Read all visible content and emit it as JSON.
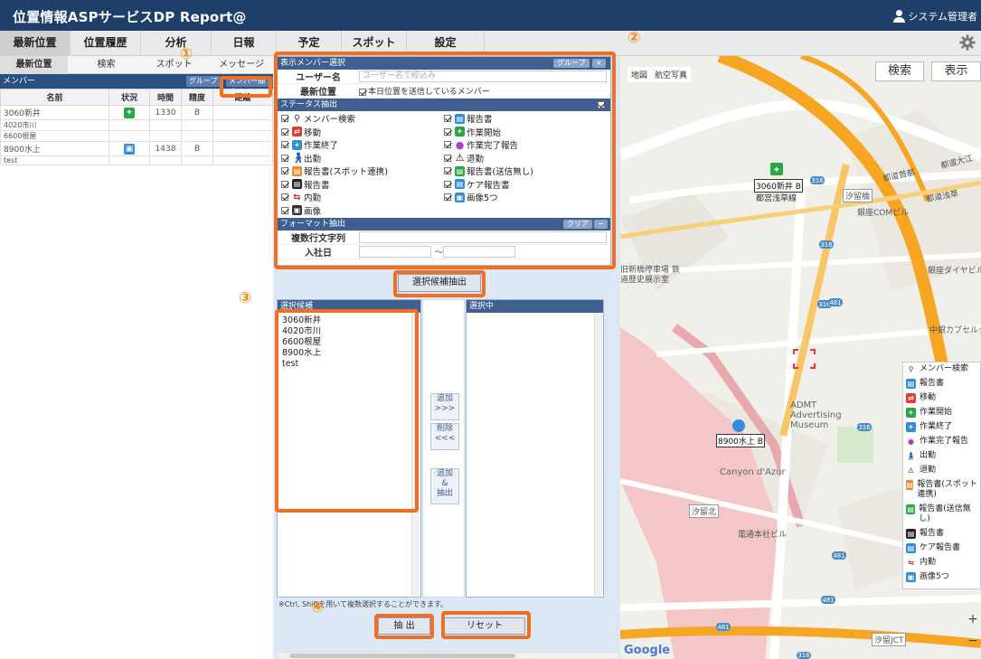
{
  "app": {
    "title": "位置情報ASPサービスDP Report@",
    "user": "システム管理者"
  },
  "nav": [
    "最新位置",
    "位置履歴",
    "分析",
    "日報",
    "予定",
    "スポット",
    "設定"
  ],
  "subtabs": [
    "最新位置",
    "検索",
    "スポット",
    "メッセージ"
  ],
  "member_bar": {
    "label": "メンバー",
    "group_btn": "グループ",
    "member_btn": "メンバー抽出"
  },
  "member_table": {
    "headers": [
      "名前",
      "状況",
      "時間",
      "精度",
      "距離"
    ],
    "rows": [
      {
        "name": "3060新井",
        "time": "1330",
        "acc": "B"
      },
      {
        "name": "4020市川",
        "time": "",
        "acc": ""
      },
      {
        "name": "6600根屋",
        "time": "",
        "acc": ""
      },
      {
        "name": "8900水上",
        "time": "1438",
        "acc": "B"
      },
      {
        "name": "test",
        "time": "",
        "acc": ""
      }
    ]
  },
  "dialog": {
    "header": "表示メンバー選択",
    "group_btn": "グループ",
    "close_btn": "×",
    "user_label": "ユーザー名",
    "user_placeholder": "ユーザー名で絞込み",
    "latest_label": "最新位置",
    "latest_check": "本日位置を送信しているメンバー",
    "status_header": "ステータス抽出",
    "statuses": [
      "メンバー検索",
      "報告書",
      "移動",
      "作業開始",
      "作業終了",
      "作業完了報告",
      "出勤",
      "退勤",
      "報告書(スポット連携)",
      "報告書(送信無し)",
      "報告書",
      "ケア報告書",
      "内勤",
      "画像5つ",
      "画像"
    ],
    "format_header": "フォーマット抽出",
    "clear_btn": "クリア",
    "minus_btn": "−",
    "multi_label": "複数行文字列",
    "join_label": "入社日",
    "tilde": "〜"
  },
  "extract_candidates_btn": "選択候補抽出",
  "candidates": {
    "header": "選択候補",
    "items": [
      "3060新井",
      "4020市川",
      "6600根屋",
      "8900水上",
      "test"
    ]
  },
  "selected": {
    "header": "選択中"
  },
  "move": {
    "add": "追加\n>>>",
    "remove": "削除\n<<<",
    "add_extract": "追加\n&\n抽出"
  },
  "note": "※Ctrl, Shiftを用いて複数選択することができます。",
  "actions": {
    "extract": "抽 出",
    "reset": "リセット"
  },
  "callouts": [
    "①",
    "②",
    "③",
    "④"
  ],
  "map": {
    "type_map": "地図",
    "type_photo": "航空写真",
    "search_btn": "検索",
    "display_btn": "表示",
    "pin1": "3060新井 B",
    "pin2": "8900水上 B",
    "station1": "都営浅草線",
    "poi1": "ADMT Advertising Museum",
    "poi2": "Canyon d'Azur",
    "poi3": "電通本社ビル",
    "poi4": "旧新橋停車場 鉄道歴史展示室",
    "poi5": "中銀カプセルタワー",
    "poi6": "銀座COMビル",
    "poi7": "銀座ダイヤビル",
    "road1": "都道首都",
    "road2": "都道浅草",
    "road3": "都道大江",
    "pill1": "汐留橋",
    "pill2": "汐留JCT",
    "pill3": "汐留北",
    "google": "Google",
    "zoom_in": "+",
    "zoom_out": "−",
    "legend": [
      "メンバー検索",
      "報告書",
      "移動",
      "作業開始",
      "作業終了",
      "作業完了報告",
      "出勤",
      "退勤",
      "報告書(スポット連携)",
      "報告書(送信無し)",
      "報告書",
      "ケア報告書",
      "内勤",
      "画像5つ"
    ]
  },
  "colors": {
    "header": "#1f3f6b",
    "highlight": "#f26f21",
    "panel_bg": "#dde8f6"
  }
}
